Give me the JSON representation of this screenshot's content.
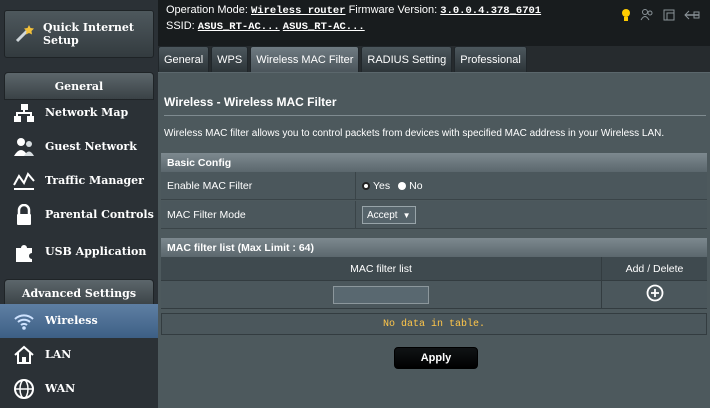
{
  "sidebar": {
    "quick_setup": "Quick Internet Setup",
    "general_header": "General",
    "general_items": [
      {
        "label": "Network Map",
        "icon": "network-map-icon"
      },
      {
        "label": "Guest Network",
        "icon": "guest-network-icon"
      },
      {
        "label": "Traffic Manager",
        "icon": "traffic-manager-icon"
      },
      {
        "label": "Parental Controls",
        "icon": "parental-controls-icon"
      },
      {
        "label": "USB Application",
        "icon": "usb-application-icon"
      }
    ],
    "advanced_header": "Advanced Settings",
    "advanced_items": [
      {
        "label": "Wireless",
        "icon": "wifi-icon",
        "active": true
      },
      {
        "label": "LAN",
        "icon": "home-icon"
      },
      {
        "label": "WAN",
        "icon": "globe-icon"
      }
    ]
  },
  "header": {
    "op_mode_label": "Operation Mode:",
    "op_mode_value": "Wireless router",
    "firmware_label": "Firmware Version:",
    "firmware_value": "3.0.0.4.378_6701",
    "ssid_label": "SSID:",
    "ssid_1": "ASUS_RT-AC...",
    "ssid_2": "ASUS_RT-AC..."
  },
  "tabs": [
    "General",
    "WPS",
    "Wireless MAC Filter",
    "RADIUS Setting",
    "Professional"
  ],
  "active_tab": "Wireless MAC Filter",
  "main": {
    "title": "Wireless - Wireless MAC Filter",
    "description": "Wireless MAC filter allows you to control packets from devices with specified MAC address in your Wireless LAN.",
    "basic_config": "Basic Config",
    "enable_label": "Enable MAC Filter",
    "yes_label": "Yes",
    "no_label": "No",
    "enable_value": "Yes",
    "mode_label": "MAC Filter Mode",
    "mode_value": "Accept",
    "list_header": "MAC filter list (Max Limit : 64)",
    "col_list": "MAC filter list",
    "col_action": "Add / Delete",
    "mac_input_value": "",
    "empty_text": "No data in table.",
    "apply_label": "Apply"
  },
  "colors": {
    "accent_active": "#4a6d96",
    "warning_text": "#ffc64a",
    "panel": "#4d595d"
  }
}
